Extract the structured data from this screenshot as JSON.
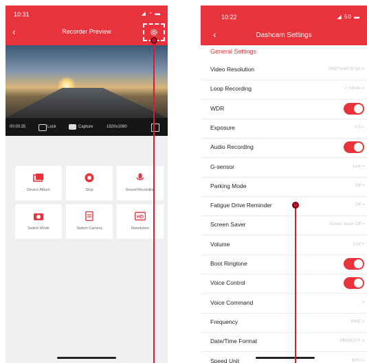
{
  "left_phone": {
    "status_time": "10:31",
    "status_icons": "◢ ◔ ▬",
    "back_label": "‹",
    "title": "Recorder Preview",
    "gear_icon": "gear-icon",
    "video_bar": {
      "timer": "00:00:35",
      "lock": "Lock",
      "capture": "Capture",
      "resolution": "1920x1080"
    },
    "grid": [
      {
        "label": "Device Album",
        "icon": "album-icon"
      },
      {
        "label": "Stop",
        "icon": "stop-icon"
      },
      {
        "label": "Sound Recording",
        "icon": "mic-icon"
      },
      {
        "label": "Switch Mode",
        "icon": "camera-icon"
      },
      {
        "label": "Switch Camera",
        "icon": "switch-camera-icon"
      },
      {
        "label": "Resolution",
        "icon": "hd-icon"
      }
    ],
    "hd_badge": "HD"
  },
  "right_phone": {
    "status_time": "10:22",
    "status_icons": "◢ 50 ▬",
    "back_label": "‹",
    "title": "Dashcam Settings",
    "section": "General Settings",
    "rows": [
      {
        "label": "Video Resolution",
        "value": "2560*1440 30 fps >",
        "toggle": false
      },
      {
        "label": "Loop Recording",
        "value": "1 minute >",
        "toggle": false
      },
      {
        "label": "WDR",
        "value": "",
        "toggle": true
      },
      {
        "label": "Exposure",
        "value": "0.0 >",
        "toggle": false
      },
      {
        "label": "Audio Recording",
        "value": "",
        "toggle": true
      },
      {
        "label": "G-sensor",
        "value": "Low >",
        "toggle": false
      },
      {
        "label": "Parking Mode",
        "value": "Off >",
        "toggle": false
      },
      {
        "label": "Fatigue Drive Reminder",
        "value": "Off >",
        "toggle": false
      },
      {
        "label": "Screen Saver",
        "value": "Screen Saver Off >",
        "toggle": false
      },
      {
        "label": "Volume",
        "value": "Low >",
        "toggle": false
      },
      {
        "label": "Boot Ringtone",
        "value": "",
        "toggle": true
      },
      {
        "label": "Voice Control",
        "value": "",
        "toggle": true
      },
      {
        "label": "Voice Command",
        "value": ">",
        "toggle": false
      },
      {
        "label": "Frequency",
        "value": "60HZ >",
        "toggle": false
      },
      {
        "label": "Date/Time Format",
        "value": "MM/DD/YY >",
        "toggle": false
      },
      {
        "label": "Speed Unit",
        "value": "MPH >",
        "toggle": false
      }
    ]
  },
  "colors": {
    "accent": "#e8323c",
    "pointer": "#d81b3a"
  }
}
